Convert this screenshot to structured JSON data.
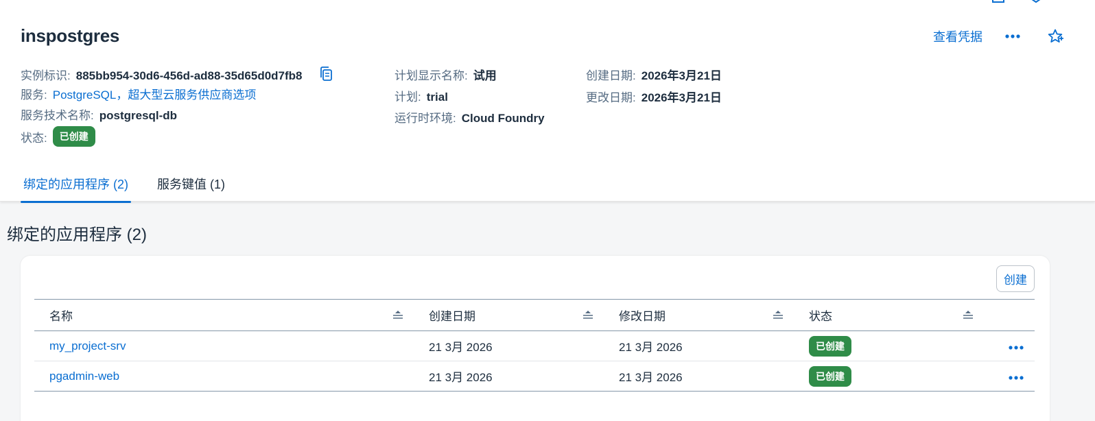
{
  "header": {
    "title": "inspostgres",
    "view_credentials": "查看凭据",
    "attributes_left": [
      {
        "label": "实例标识:",
        "value": "885bb954-30d6-456d-ad88-35d65d0d7fb8"
      },
      {
        "label": "服务:",
        "value": "PostgreSQL，超大型云服务供应商选项"
      },
      {
        "label": "服务技术名称:",
        "value": "postgresql-db"
      },
      {
        "label": "状态:",
        "value": "已创建"
      }
    ],
    "attributes_mid": [
      {
        "label": "计划显示名称:",
        "value": "试用"
      },
      {
        "label": "计划:",
        "value": "trial"
      },
      {
        "label": "运行时环境:",
        "value": "Cloud Foundry"
      }
    ],
    "attributes_right": [
      {
        "label": "创建日期:",
        "value": "2026年3月21日"
      },
      {
        "label": "更改日期:",
        "value": "2026年3月21日"
      }
    ]
  },
  "tabs": [
    {
      "label": "绑定的应用程序 (2)",
      "active": true
    },
    {
      "label": "服务键值 (1)",
      "active": false
    }
  ],
  "section": {
    "title": "绑定的应用程序 (2)",
    "create_label": "创建"
  },
  "table": {
    "columns": [
      "名称",
      "创建日期",
      "修改日期",
      "状态"
    ],
    "rows": [
      {
        "name": "my_project-srv",
        "created": "21 3月 2026",
        "modified": "21 3月 2026",
        "status": "已创建"
      },
      {
        "name": "pgadmin-web",
        "created": "21 3月 2026",
        "modified": "21 3月 2026",
        "status": "已创建"
      }
    ]
  },
  "colors": {
    "accent": "#0a6ed1",
    "success": "#2f8c48",
    "background": "#f5f6f7"
  },
  "icons": [
    "copy-icon",
    "more-icon",
    "star-icon",
    "sort-icon",
    "expand-icon"
  ]
}
